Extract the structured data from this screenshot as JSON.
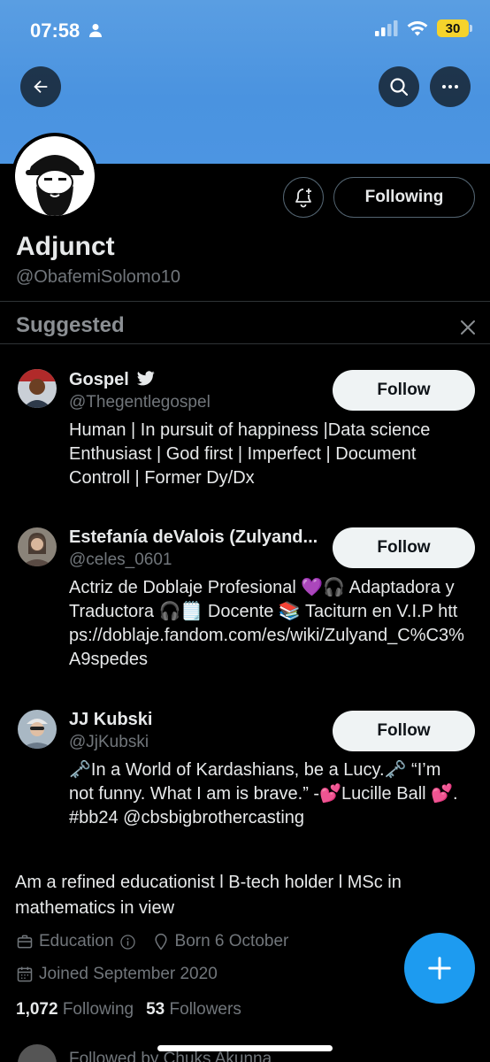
{
  "status_bar": {
    "time": "07:58",
    "battery": "30"
  },
  "profile": {
    "display_name": "Adjunct",
    "handle": "@ObafemiSolomo10",
    "following_button": "Following",
    "bio": "Am a refined educationist l B-tech holder l MSc in mathematics in view",
    "category": "Education",
    "born": "Born 6 October",
    "joined": "Joined September 2020",
    "following_count": "1,072",
    "following_label": "Following",
    "followers_count": "53",
    "followers_label": "Followers",
    "followed_by": "Followed by Chuks Akunna"
  },
  "suggested": {
    "title": "Suggested",
    "items": [
      {
        "name": "Gospel",
        "handle": "@Thegentlegospel",
        "follow_label": "Follow",
        "bio": "Human | In pursuit of happiness |Data science Enthusiast | God first | Imperfect | Document Controll | Former Dy/Dx"
      },
      {
        "name": "Estefanía deValois (Zulyand...",
        "handle": "@celes_0601",
        "follow_label": "Follow",
        "bio": "Actriz de Doblaje Profesional 💜🎧 Adaptadora y Traductora 🎧🗒️ Docente 📚 Taciturn en V.I.P https://doblaje.fandom.com/es/wiki/Zulyand_C%C3%A9spedes"
      },
      {
        "name": "JJ Kubski",
        "handle": "@JjKubski",
        "follow_label": "Follow",
        "bio": "🗝️In a World of Kardashians, be a Lucy.🗝️ “I’m not funny. What I am is brave.” -💕Lucille Ball 💕. #bb24 @cbsbigbrothercasting"
      }
    ]
  },
  "colors": {
    "accent": "#1d9bf0",
    "banner": "#4a93e0",
    "background": "#000000"
  }
}
